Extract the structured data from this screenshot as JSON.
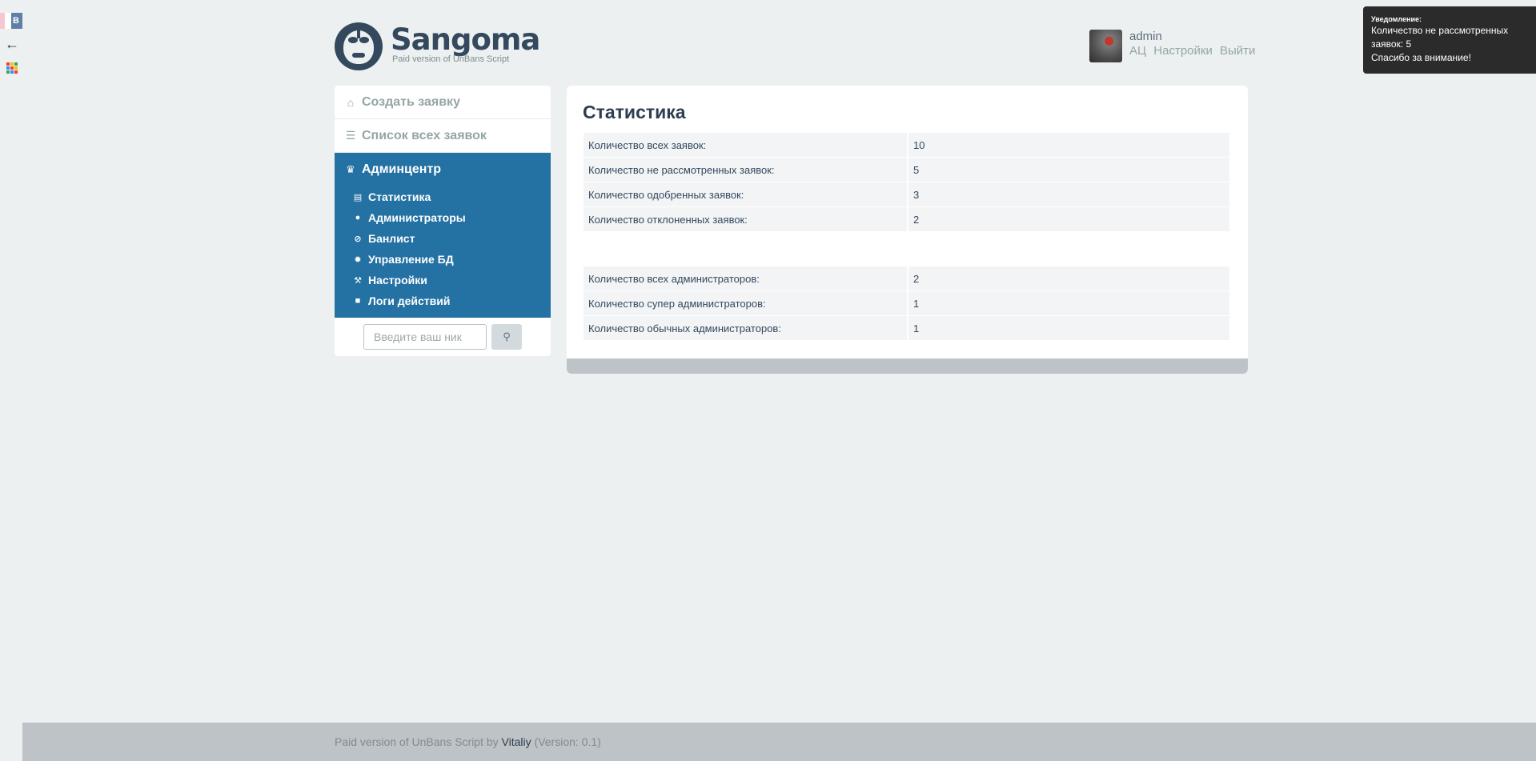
{
  "browser": {
    "tab_letter": "B",
    "back_icon": "arrow-left-icon",
    "apps_icon": "apps-grid-icon",
    "apps_colors": [
      "#ea4335",
      "#fbbc05",
      "#34a853",
      "#4285f4",
      "#ea4335",
      "#fbbc05",
      "#34a853",
      "#4285f4",
      "#ea4335"
    ]
  },
  "header": {
    "logo_title": "Sangoma",
    "logo_subtitle": "Paid version of UnBans Script",
    "user_name": "admin",
    "links": [
      "АЦ",
      "Настройки",
      "Выйти"
    ]
  },
  "notification": {
    "title": "Уведомление:",
    "line1": "Количество не рассмотренных заявок: 5",
    "line2": "Спасибо за внимание!"
  },
  "sidebar": {
    "items": [
      {
        "label": "Создать заявку",
        "icon": "home-icon"
      },
      {
        "label": "Список всех заявок",
        "icon": "list-icon"
      }
    ],
    "admin_center": {
      "label": "Админцентр",
      "icon": "crown-icon",
      "subitems": [
        {
          "label": "Статистика",
          "icon": "clipboard-icon"
        },
        {
          "label": "Администраторы",
          "icon": "user-icon"
        },
        {
          "label": "Банлист",
          "icon": "ban-icon"
        },
        {
          "label": "Управление БД",
          "icon": "gear-icon"
        },
        {
          "label": "Настройки",
          "icon": "wrench-icon"
        },
        {
          "label": "Логи действий",
          "icon": "log-icon"
        }
      ]
    },
    "search": {
      "placeholder": "Введите ваш ник",
      "button_icon": "search-icon"
    }
  },
  "main": {
    "title": "Статистика",
    "requests_table": [
      {
        "label": "Количество всех заявок:",
        "value": "10"
      },
      {
        "label": "Количество не рассмотренных заявок:",
        "value": "5"
      },
      {
        "label": "Количество одобренных заявок:",
        "value": "3"
      },
      {
        "label": "Количество отклоненных заявок:",
        "value": "2"
      }
    ],
    "admins_table": [
      {
        "label": "Количество всех администраторов:",
        "value": "2"
      },
      {
        "label": "Количество супер администраторов:",
        "value": "1"
      },
      {
        "label": "Количество обычных администраторов:",
        "value": "1"
      }
    ]
  },
  "footer": {
    "prefix": "Paid version of UnBans Script by ",
    "author": "Vitaliy",
    "suffix": " (Version: 0.1)"
  },
  "colors": {
    "background": "#ecf0f1",
    "admin_block": "#2471a3",
    "notification": "#2b2b2b",
    "footer": "#bdc3c7"
  }
}
